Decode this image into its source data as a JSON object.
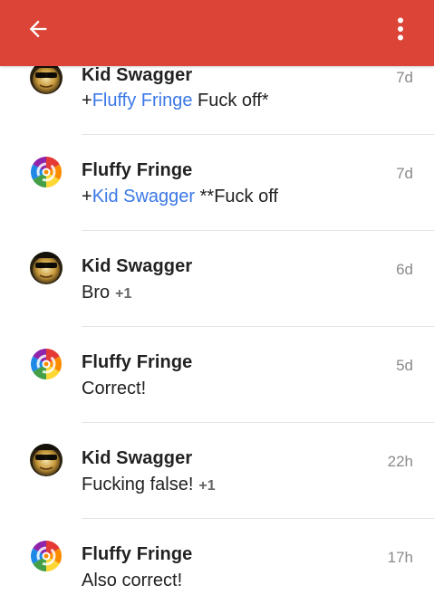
{
  "appbar": {
    "color": "#db4437",
    "back_icon": "arrow-back-icon",
    "menu_icon": "more-vert-icon"
  },
  "colors": {
    "mention": "#3b78e7",
    "timestamp": "#8a8a8a"
  },
  "comments": [
    {
      "author": "Kid Swagger",
      "avatar": "kid-swagger-avatar",
      "time": "7d",
      "prefix": "+",
      "mention": "Fluffy Fringe",
      "text": " Fuck off*",
      "plus_ones": ""
    },
    {
      "author": "Fluffy Fringe",
      "avatar": "fluffy-fringe-avatar",
      "time": "7d",
      "prefix": "+",
      "mention": "Kid Swagger",
      "text": " **Fuck off",
      "plus_ones": ""
    },
    {
      "author": "Kid Swagger",
      "avatar": "kid-swagger-avatar",
      "time": "6d",
      "prefix": "",
      "mention": "",
      "text": "Bro",
      "plus_ones": "+1"
    },
    {
      "author": "Fluffy Fringe",
      "avatar": "fluffy-fringe-avatar",
      "time": "5d",
      "prefix": "",
      "mention": "",
      "text": "Correct!",
      "plus_ones": ""
    },
    {
      "author": "Kid Swagger",
      "avatar": "kid-swagger-avatar",
      "time": "22h",
      "prefix": "",
      "mention": "",
      "text": "Fucking false!",
      "plus_ones": "+1"
    },
    {
      "author": "Fluffy Fringe",
      "avatar": "fluffy-fringe-avatar",
      "time": "17h",
      "prefix": "",
      "mention": "",
      "text": "Also correct!",
      "plus_ones": ""
    }
  ]
}
